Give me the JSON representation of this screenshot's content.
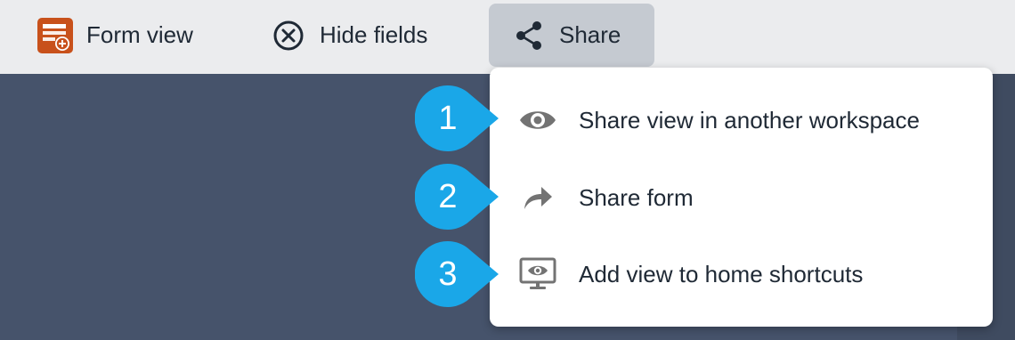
{
  "toolbar": {
    "form_view_label": "Form view",
    "hide_fields_label": "Hide fields",
    "share_label": "Share"
  },
  "share_menu": {
    "items": [
      {
        "label": "Share view in another workspace",
        "icon": "eye-icon",
        "callout": "1"
      },
      {
        "label": "Share form",
        "icon": "forward-arrow-icon",
        "callout": "2"
      },
      {
        "label": "Add view to home shortcuts",
        "icon": "monitor-eye-icon",
        "callout": "3"
      }
    ]
  },
  "colors": {
    "toolbar_bg": "#ebecee",
    "share_active_bg": "#c5cad1",
    "page_bg": "#46536b",
    "callout": "#1aa7e8",
    "form_icon": "#c8511b",
    "text": "#1f2935",
    "menu_icon": "#737373"
  }
}
